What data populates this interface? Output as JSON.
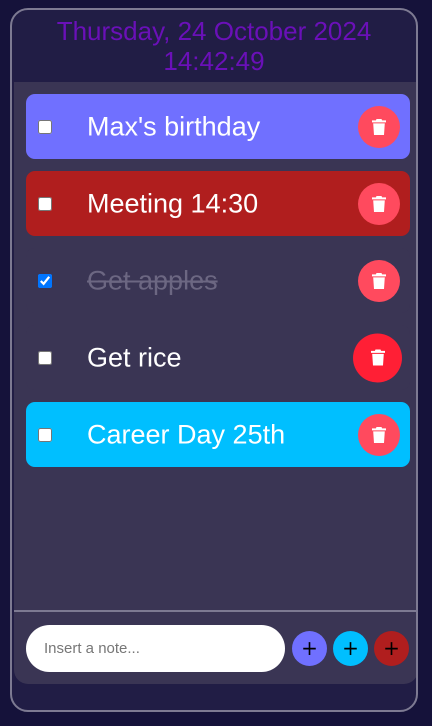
{
  "header": {
    "date": "Thursday, 24 October 2024",
    "time": "14:42:49"
  },
  "notes": [
    {
      "text": "Max's birthday",
      "checked": false,
      "color": "#7070ff"
    },
    {
      "text": "Meeting 14:30",
      "checked": false,
      "color": "#b01e1e"
    },
    {
      "text": "Get apples",
      "checked": true,
      "color": "#3a3554"
    },
    {
      "text": "Get rice",
      "checked": false,
      "color": "#3a3554"
    },
    {
      "text": "Career Day 25th",
      "checked": false,
      "color": "#00bfff"
    }
  ],
  "delete_icon": "trash-icon",
  "input": {
    "placeholder": "Insert a note...",
    "value": ""
  },
  "add_buttons": [
    {
      "label": "+",
      "color": "#7070ff"
    },
    {
      "label": "+",
      "color": "#00bfff"
    },
    {
      "label": "+",
      "color": "#b01e1e"
    }
  ]
}
